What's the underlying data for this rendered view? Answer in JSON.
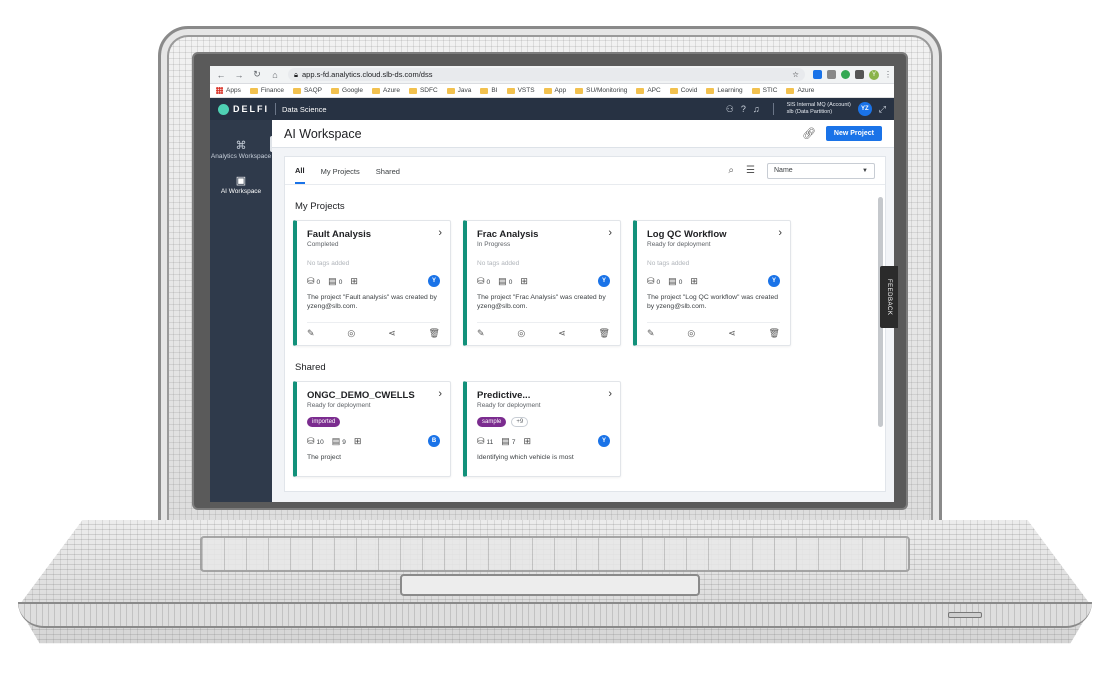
{
  "browser": {
    "url": "app.s-fd.analytics.cloud.slb-ds.com/dss",
    "bookmarks": [
      "Apps",
      "Finance",
      "SAQP",
      "Google",
      "Azure",
      "SDFC",
      "Java",
      "BI",
      "VSTS",
      "App",
      "SU/Monitoring",
      "APC",
      "Covid",
      "Learning",
      "STIC",
      "Azure"
    ],
    "profile_initial": "Y"
  },
  "header": {
    "brand": "DELFI",
    "app_name": "Data Science",
    "account_line1": "SIS Internal MQ",
    "account_label": "(Account)",
    "account_line2": "slb",
    "partition_label": "(Data Partition)",
    "user_initials": "YZ"
  },
  "left_nav": {
    "items": [
      {
        "label": "Analytics Workspace"
      },
      {
        "label": "AI Workspace"
      }
    ]
  },
  "page": {
    "title": "AI Workspace",
    "new_project_label": "New Project"
  },
  "tabs": [
    "All",
    "My Projects",
    "Shared"
  ],
  "sort": {
    "selected": "Name"
  },
  "sections": {
    "my_projects": "My Projects",
    "shared": "Shared"
  },
  "my_projects": [
    {
      "title": "Fault Analysis",
      "status": "Completed",
      "tags": "No tags added",
      "datasets": "0",
      "notebooks": "0",
      "owner": "Y",
      "desc": "The project \"Fault analysis\" was created by yzeng@slb.com."
    },
    {
      "title": "Frac Analysis",
      "status": "In Progress",
      "tags": "No tags added",
      "datasets": "0",
      "notebooks": "0",
      "owner": "Y",
      "desc": "The project \"Frac Analysis\" was created by yzeng@slb.com."
    },
    {
      "title": "Log QC Workflow",
      "status": "Ready for deployment",
      "tags": "No tags added",
      "datasets": "0",
      "notebooks": "0",
      "owner": "Y",
      "desc": "The project \"Log QC workflow\" was created by yzeng@slb.com."
    }
  ],
  "shared_projects": [
    {
      "title": "ONGC_DEMO_CWELLS",
      "status": "Ready for deployment",
      "tag": "imported",
      "tag_more": "",
      "datasets": "10",
      "notebooks": "9",
      "owner": "B",
      "desc": "The project"
    },
    {
      "title": "Predictive...",
      "status": "Ready for deployment",
      "tag": "sample",
      "tag_more": "+9",
      "datasets": "11",
      "notebooks": "7",
      "owner": "Y",
      "desc": "Identifying which vehicle is most"
    }
  ],
  "feedback_label": "FEEDBACK",
  "colors": {
    "accent": "#1a73e8",
    "card_bar": "#12917a",
    "nav_bg": "#2f3a4b",
    "tag_purple": "#7b2c8f"
  }
}
